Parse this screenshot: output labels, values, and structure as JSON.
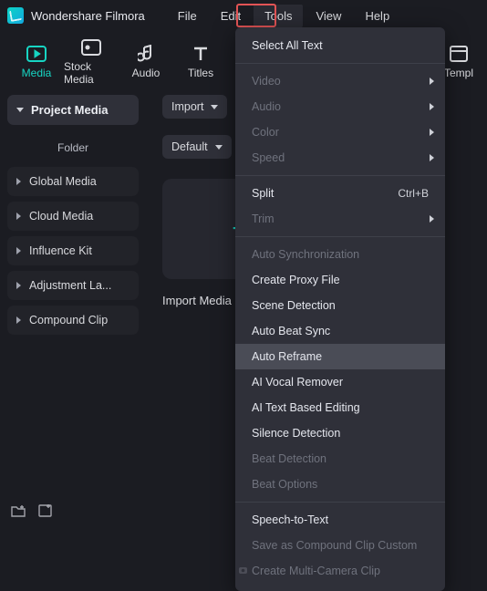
{
  "app": {
    "name": "Wondershare Filmora"
  },
  "menubar": [
    "File",
    "Edit",
    "Tools",
    "View",
    "Help"
  ],
  "modetabs": {
    "media": "Media",
    "stock": "Stock Media",
    "audio": "Audio",
    "titles": "Titles",
    "templ": "Templ"
  },
  "sidebar": {
    "head": "Project Media",
    "sub": "Folder",
    "items": [
      "Global Media",
      "Cloud Media",
      "Influence Kit",
      "Adjustment La...",
      "Compound Clip"
    ]
  },
  "content": {
    "import": "Import",
    "default": "Default",
    "drop_label": "Import Media"
  },
  "tools_menu": {
    "select_all": "Select All Text",
    "video": "Video",
    "audio": "Audio",
    "color": "Color",
    "speed": "Speed",
    "split": "Split",
    "split_kb": "Ctrl+B",
    "trim": "Trim",
    "autosync": "Auto Synchronization",
    "proxy": "Create Proxy File",
    "scene": "Scene Detection",
    "beatsync": "Auto Beat Sync",
    "reframe": "Auto Reframe",
    "vocal": "AI Vocal Remover",
    "textedit": "AI Text Based Editing",
    "silence": "Silence Detection",
    "beatdet": "Beat Detection",
    "beatopt": "Beat Options",
    "stt": "Speech-to-Text",
    "compound": "Save as Compound Clip Custom",
    "multicam": "Create Multi-Camera Clip"
  }
}
